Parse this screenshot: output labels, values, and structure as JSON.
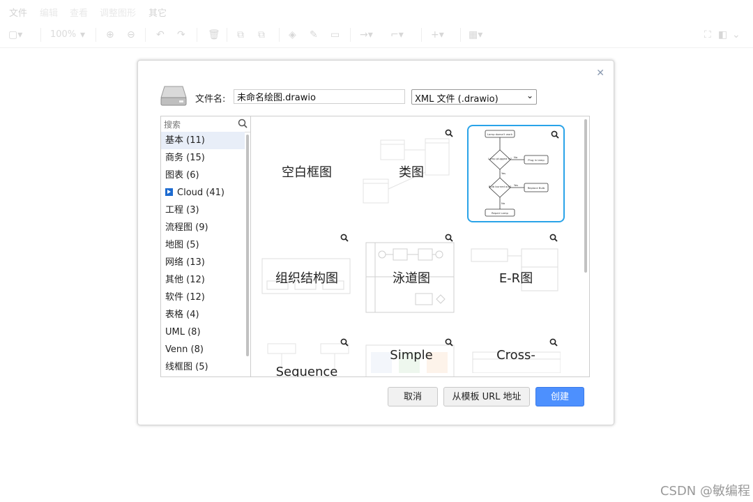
{
  "menu": [
    "文件",
    "编辑",
    "查看",
    "调整图形",
    "其它"
  ],
  "toolbar": {
    "zoom": "100%"
  },
  "dialog": {
    "filename_label": "文件名:",
    "filename_value": "未命名绘图.drawio",
    "format_selected": "XML 文件 (.drawio)",
    "search_placeholder": "搜索",
    "categories": [
      "基本 (11)",
      "商务 (15)",
      "图表 (6)",
      "Cloud (41)",
      "工程 (3)",
      "流程图 (9)",
      "地图 (5)",
      "网络 (13)",
      "其他 (12)",
      "软件 (12)",
      "表格 (4)",
      "UML (8)",
      "Venn (8)",
      "线框图 (5)"
    ],
    "templates": {
      "blank": "空白框图",
      "class": "类图",
      "org": "组织结构图",
      "swimlane": "泳道图",
      "er": "E-R图",
      "sequence": "Sequence",
      "simple": "Simple",
      "cross": "Cross-"
    },
    "flowchart_thumb": {
      "start": "Lamp doesn't work",
      "q1": "Lamp plugged in?",
      "a1": "Plug in lamp",
      "q2": "Bulb burned out?",
      "a2": "Replace Bulb",
      "end": "Repair Lamp",
      "no": "No",
      "yes": "Yes"
    },
    "buttons": {
      "cancel": "取消",
      "from_url": "从模板 URL 地址",
      "create": "创建"
    }
  },
  "watermark": "CSDN @敏编程",
  "colors": {
    "accent": "#4d90fe",
    "selection": "#29a3e8",
    "arrow": "#e00000"
  }
}
